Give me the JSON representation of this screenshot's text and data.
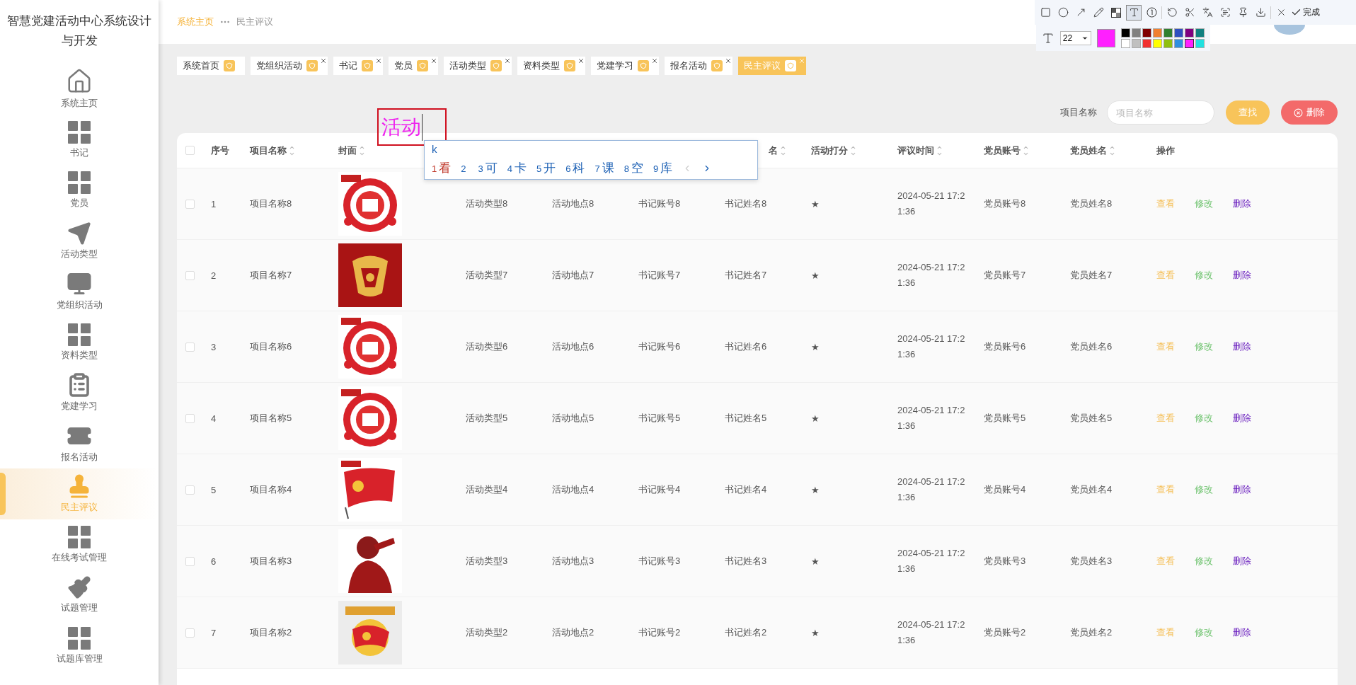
{
  "sidebar": {
    "title": "智慧党建活动中心系统设计与开发",
    "items": [
      {
        "label": "系统主页",
        "kind": "home",
        "selected": false
      },
      {
        "label": "书记",
        "kind": "grid",
        "selected": false
      },
      {
        "label": "党员",
        "kind": "grid",
        "selected": false
      },
      {
        "label": "活动类型",
        "kind": "plane",
        "selected": false
      },
      {
        "label": "党组织活动",
        "kind": "monitor",
        "selected": false
      },
      {
        "label": "资料类型",
        "kind": "grid",
        "selected": false
      },
      {
        "label": "党建学习",
        "kind": "clipboard",
        "selected": false
      },
      {
        "label": "报名活动",
        "kind": "ticket",
        "selected": false
      },
      {
        "label": "民主评议",
        "kind": "stamp",
        "selected": true
      },
      {
        "label": "在线考试管理",
        "kind": "grid",
        "selected": false
      },
      {
        "label": "试题管理",
        "kind": "brush",
        "selected": false
      },
      {
        "label": "试题库管理",
        "kind": "grid",
        "selected": false
      }
    ]
  },
  "breadcrumb": {
    "home": "系统主页",
    "current": "民主评议"
  },
  "tabs": [
    {
      "label": "系统首页",
      "closable": false,
      "selected": false
    },
    {
      "label": "党组织活动",
      "closable": true,
      "selected": false
    },
    {
      "label": "书记",
      "closable": true,
      "selected": false
    },
    {
      "label": "党员",
      "closable": true,
      "selected": false
    },
    {
      "label": "活动类型",
      "closable": true,
      "selected": false
    },
    {
      "label": "资料类型",
      "closable": true,
      "selected": false
    },
    {
      "label": "党建学习",
      "closable": true,
      "selected": false
    },
    {
      "label": "报名活动",
      "closable": true,
      "selected": false
    },
    {
      "label": "民主评议",
      "closable": true,
      "selected": true
    }
  ],
  "search": {
    "label": "项目名称",
    "placeholder": "项目名称",
    "buttons": [
      {
        "kind": "search",
        "label": "查找"
      },
      {
        "kind": "delete",
        "label": "删除"
      }
    ]
  },
  "table": {
    "columns": [
      {
        "kind": "check",
        "checked": false
      },
      {
        "kind": "text",
        "label": "序号",
        "sortable": false
      },
      {
        "kind": "text",
        "label": "项目名称",
        "sortable": true
      },
      {
        "kind": "text",
        "label": "封面",
        "sortable": true
      },
      {
        "kind": "covered"
      },
      {
        "kind": "covered"
      },
      {
        "kind": "covered"
      },
      {
        "kind": "partial",
        "label": "名",
        "sortable": true
      },
      {
        "kind": "text",
        "label": "活动打分",
        "sortable": true
      },
      {
        "kind": "text",
        "label": "评议时间",
        "sortable": true
      },
      {
        "kind": "text",
        "label": "党员账号",
        "sortable": true
      },
      {
        "kind": "text",
        "label": "党员姓名",
        "sortable": true
      },
      {
        "kind": "text",
        "label": "操作",
        "sortable": false
      }
    ],
    "rows": [
      {
        "checked": false,
        "index": "1",
        "name": "项目名称8",
        "activity_type": "活动类型8",
        "location": "活动地点8",
        "secretary_account": "书记账号8",
        "secretary_name": "书记姓名8",
        "rating": "★",
        "time": "2024-05-21 17:21:36",
        "member_account": "党员账号8",
        "member_name": "党员姓名8",
        "actions": [
          {
            "kind": "view",
            "label": "查看"
          },
          {
            "kind": "edit",
            "label": "修改"
          },
          {
            "kind": "delete",
            "label": "删除"
          }
        ]
      },
      {
        "checked": false,
        "index": "2",
        "name": "项目名称7",
        "activity_type": "活动类型7",
        "location": "活动地点7",
        "secretary_account": "书记账号7",
        "secretary_name": "书记姓名7",
        "rating": "★",
        "time": "2024-05-21 17:21:36",
        "member_account": "党员账号7",
        "member_name": "党员姓名7",
        "actions": [
          {
            "kind": "view",
            "label": "查看"
          },
          {
            "kind": "edit",
            "label": "修改"
          },
          {
            "kind": "delete",
            "label": "删除"
          }
        ]
      },
      {
        "checked": false,
        "index": "3",
        "name": "项目名称6",
        "activity_type": "活动类型6",
        "location": "活动地点6",
        "secretary_account": "书记账号6",
        "secretary_name": "书记姓名6",
        "rating": "★",
        "time": "2024-05-21 17:21:36",
        "member_account": "党员账号6",
        "member_name": "党员姓名6",
        "actions": [
          {
            "kind": "view",
            "label": "查看"
          },
          {
            "kind": "edit",
            "label": "修改"
          },
          {
            "kind": "delete",
            "label": "删除"
          }
        ]
      },
      {
        "checked": false,
        "index": "4",
        "name": "项目名称5",
        "activity_type": "活动类型5",
        "location": "活动地点5",
        "secretary_account": "书记账号5",
        "secretary_name": "书记姓名5",
        "rating": "★",
        "time": "2024-05-21 17:21:36",
        "member_account": "党员账号5",
        "member_name": "党员姓名5",
        "actions": [
          {
            "kind": "view",
            "label": "查看"
          },
          {
            "kind": "edit",
            "label": "修改"
          },
          {
            "kind": "delete",
            "label": "删除"
          }
        ]
      },
      {
        "checked": false,
        "index": "5",
        "name": "项目名称4",
        "activity_type": "活动类型4",
        "location": "活动地点4",
        "secretary_account": "书记账号4",
        "secretary_name": "书记姓名4",
        "rating": "★",
        "time": "2024-05-21 17:21:36",
        "member_account": "党员账号4",
        "member_name": "党员姓名4",
        "actions": [
          {
            "kind": "view",
            "label": "查看"
          },
          {
            "kind": "edit",
            "label": "修改"
          },
          {
            "kind": "delete",
            "label": "删除"
          }
        ]
      },
      {
        "checked": false,
        "index": "6",
        "name": "项目名称3",
        "activity_type": "活动类型3",
        "location": "活动地点3",
        "secretary_account": "书记账号3",
        "secretary_name": "书记姓名3",
        "rating": "★",
        "time": "2024-05-21 17:21:36",
        "member_account": "党员账号3",
        "member_name": "党员姓名3",
        "actions": [
          {
            "kind": "view",
            "label": "查看"
          },
          {
            "kind": "edit",
            "label": "修改"
          },
          {
            "kind": "delete",
            "label": "删除"
          }
        ]
      },
      {
        "checked": false,
        "index": "7",
        "name": "项目名称2",
        "activity_type": "活动类型2",
        "location": "活动地点2",
        "secretary_account": "书记账号2",
        "secretary_name": "书记姓名2",
        "rating": "★",
        "time": "2024-05-21 17:21:36",
        "member_account": "党员账号2",
        "member_name": "党员姓名2",
        "actions": [
          {
            "kind": "view",
            "label": "查看"
          },
          {
            "kind": "edit",
            "label": "修改"
          },
          {
            "kind": "delete",
            "label": "删除"
          }
        ]
      }
    ]
  },
  "annotation": {
    "text": "活动"
  },
  "ime": {
    "input": "k",
    "candidates": [
      {
        "number": "1",
        "text": "看",
        "selected": true
      },
      {
        "number": "2",
        "selected": false
      },
      {
        "number": "3",
        "text": "可",
        "selected": false
      },
      {
        "number": "4",
        "text": "卡",
        "selected": false
      },
      {
        "number": "5",
        "text": "开",
        "selected": false
      },
      {
        "number": "6",
        "text": "科",
        "selected": false
      },
      {
        "number": "7",
        "text": "课",
        "selected": false
      },
      {
        "number": "8",
        "text": "空",
        "selected": false
      },
      {
        "number": "9",
        "text": "库",
        "selected": false
      }
    ]
  },
  "capture_toolbar": {
    "tools": [
      {
        "kind": "rectangle",
        "selected": false
      },
      {
        "kind": "ellipse",
        "selected": false
      },
      {
        "kind": "arrow",
        "selected": false
      },
      {
        "kind": "pencil",
        "selected": false
      },
      {
        "kind": "mosaic",
        "selected": false
      },
      {
        "kind": "text",
        "selected": true
      },
      {
        "kind": "number",
        "selected": false
      },
      {
        "kind": "undo",
        "selected": false
      },
      {
        "kind": "cut",
        "selected": false
      },
      {
        "kind": "translate",
        "selected": false
      },
      {
        "kind": "ocr",
        "selected": false
      },
      {
        "kind": "pin",
        "selected": false
      },
      {
        "kind": "download",
        "selected": false
      },
      {
        "kind": "close",
        "selected": false
      }
    ],
    "done": "完成",
    "font_size": "22",
    "palette": [
      {
        "color": "#000000",
        "selected": false
      },
      {
        "color": "#808080",
        "selected": false
      },
      {
        "color": "#800000",
        "selected": false
      },
      {
        "color": "#f08030",
        "selected": false
      },
      {
        "color": "#308030",
        "selected": false
      },
      {
        "color": "#3050c0",
        "selected": false
      },
      {
        "color": "#800080",
        "selected": false
      },
      {
        "color": "#108080",
        "selected": false
      },
      {
        "color": "#ffffff",
        "selected": false
      },
      {
        "color": "#c0c0c0",
        "selected": false
      },
      {
        "color": "#f03030",
        "selected": false
      },
      {
        "color": "#ffff00",
        "selected": false
      },
      {
        "color": "#90c010",
        "selected": false
      },
      {
        "color": "#3090e0",
        "selected": false
      },
      {
        "color": "#ff20ff",
        "selected": true
      },
      {
        "color": "#20e0e0",
        "selected": false
      }
    ]
  }
}
